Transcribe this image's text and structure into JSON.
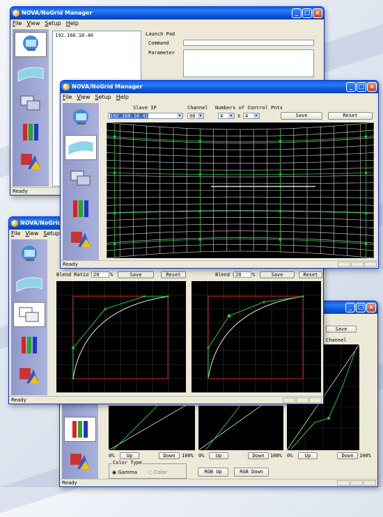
{
  "app": {
    "title": "NOVA/NoGrid Manager"
  },
  "menu": {
    "file": "File",
    "view": "View",
    "setup": "Setup",
    "help": "Help"
  },
  "status": {
    "ready": "Ready"
  },
  "launch": {
    "ip_item": "192.168.10.40",
    "title": "Launch Pad",
    "command_label": "Command",
    "parameter_label": "Parameter"
  },
  "warp": {
    "slave_ip_label": "Slave IP",
    "slave_ip_value": "192.168.10.41",
    "channel_label": "Channel",
    "channel_value": "00",
    "cp_label": "Numbers of Control Pnts",
    "cp_x": "4",
    "cp_sep": "X",
    "cp_y": "4",
    "save": "Save",
    "reset": "Reset"
  },
  "blend": {
    "ratio_label": "Blend Ratio",
    "ratio_value": "20",
    "unit": "%",
    "save": "Save",
    "reset": "Reset"
  },
  "gamma": {
    "save": "Save",
    "channel_label": "Channel",
    "pct_0": "0%",
    "pct_100": "100%",
    "up": "Up",
    "down": "Down",
    "color_type_label": "Color Type",
    "gamma_option": "Gamma",
    "color_option": "Color",
    "rgb_up": "RGB Up",
    "rgb_down": "RGB Down"
  },
  "icons": [
    "monitor-icon",
    "warp-grid-icon",
    "blend-windows-icon",
    "rgb-bars-icon",
    "color-triangle-icon"
  ],
  "colors": {
    "xp_title": "#0a5fe6",
    "grid_line": "#dddddd",
    "curve_green": "#22c83a",
    "frame_red": "#cc2222",
    "sidebar": "#9aa3d2"
  }
}
